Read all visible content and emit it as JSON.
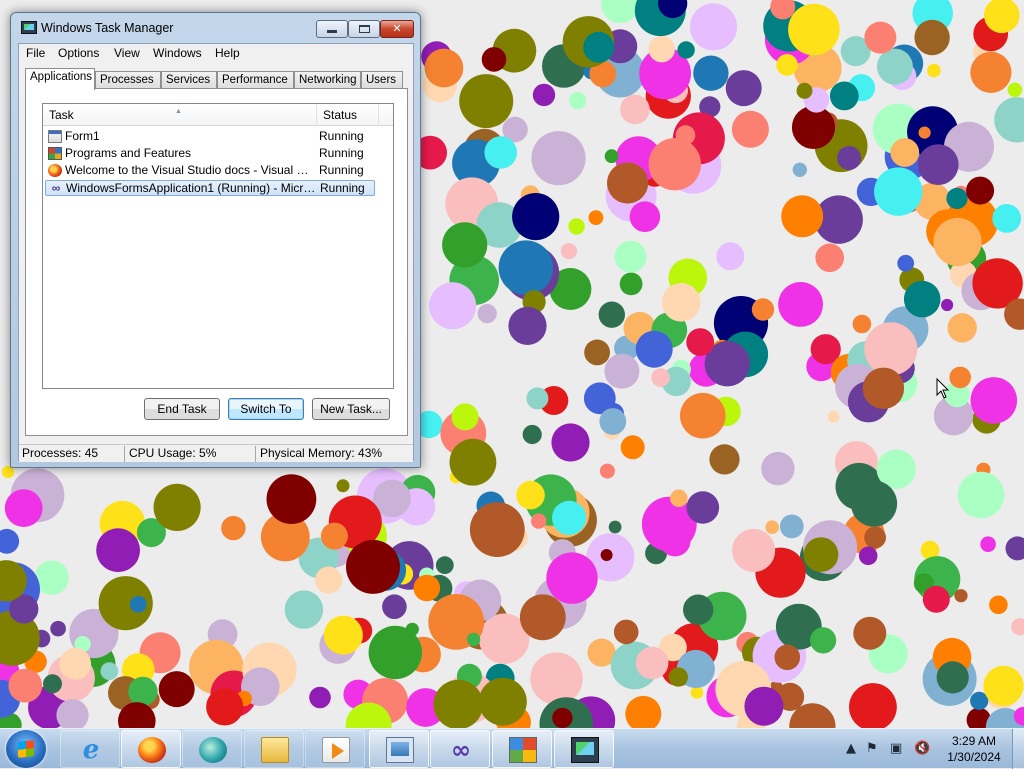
{
  "window": {
    "title": "Windows Task Manager",
    "controls": {
      "minimize": "",
      "maximize": "",
      "close": "✕"
    }
  },
  "menu": [
    "File",
    "Options",
    "View",
    "Windows",
    "Help"
  ],
  "tabs": [
    "Applications",
    "Processes",
    "Services",
    "Performance",
    "Networking",
    "Users"
  ],
  "active_tab": "Applications",
  "task_list": {
    "columns": [
      "Task",
      "Status"
    ],
    "rows": [
      {
        "task": "Form1",
        "status": "Running",
        "icon": "form-icon"
      },
      {
        "task": "Programs and Features",
        "status": "Running",
        "icon": "programs-features-icon"
      },
      {
        "task": "Welcome to the Visual Studio docs - Visual Studio...",
        "status": "Running",
        "icon": "firefox-icon"
      },
      {
        "task": "WindowsFormsApplication1 (Running) - Microsof...",
        "status": "Running",
        "icon": "visual-studio-icon",
        "selected": true
      }
    ]
  },
  "buttons": {
    "end_task": "End Task",
    "switch_to": "Switch To",
    "new_task": "New Task..."
  },
  "statusbar": {
    "processes": "Processes: 45",
    "cpu": "CPU Usage: 5%",
    "memory": "Physical Memory: 43%"
  },
  "taskbar": {
    "items": [
      "start-orb",
      "internet-explorer-icon",
      "firefox-icon",
      "windows-media-player-icon",
      "explorer-folder-icon",
      "media-center-icon",
      "task-manager-icon",
      "visual-studio-icon",
      "tiles-icon",
      "task-manager-running-icon"
    ],
    "clock_time": "3:29 AM",
    "clock_date": "1/30/2024"
  },
  "colors": {
    "taskbar": "#a9c3e0",
    "selection": "#cfe3fb",
    "close_button": "#c9452c",
    "desktop_background": "#ececec"
  }
}
